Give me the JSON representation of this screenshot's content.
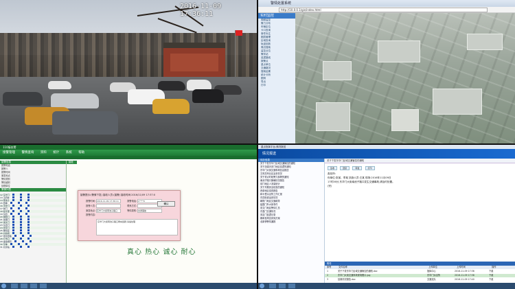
{
  "camera": {
    "timestamp": "2016-11-09 17:36:11"
  },
  "browser": {
    "window_title": "警情处置系统",
    "address": "http://10.0.0.1/gis/index.html",
    "sidebar_title": "实时监控",
    "sidebar_items": [
      "视频监控",
      "警力分布",
      "车辆定位",
      "卡口查询",
      "事件标注",
      "图层管理",
      "区域查询",
      "轨迹回放",
      "周边搜索",
      "监控点位",
      "警务站",
      "巡逻路线",
      "报警点",
      "重点单位",
      "交通路况",
      "搜索结果",
      "统计分析",
      "图例",
      "导出",
      "打印"
    ]
  },
  "system110": {
    "title": "110接处警",
    "menu": [
      "接警管理",
      "警情查询",
      "资料",
      "统计",
      "系统",
      "帮助"
    ],
    "left_header": "接警信息",
    "form_rows": [
      "报警电话",
      "报警人",
      "报警时间",
      "案发地点",
      "警情类别",
      "警情级别",
      "处理单位"
    ],
    "list_header": "警情列表",
    "list_rows": [
      "12 东华门",
      "13 王府井",
      "14 南池子",
      "15 西单",
      "16 天安门",
      "17 前门",
      "18 和平里",
      "19 东四",
      "20 朝阳门",
      "21 建国门",
      "22 崇文门",
      "23 东直门",
      "24 安定门",
      "25 雍和宫",
      "26 北新桥",
      "27 张自忠路",
      "28 灯市口",
      "29 金鱼胡同",
      "30 东单",
      "31 北京站"
    ],
    "main_header": "接处",
    "slogan": "真心 热心 诚心 耐心",
    "dialog": {
      "title": "接警提示:(警情下发) 接收人员:(接警) 接收时间:2016/11/09 17:37:0",
      "rows": [
        {
          "label": "报警时间:",
          "value": "2016-11-09 17:36:11",
          "label2": "报警电话:",
          "value2": "1****0"
        },
        {
          "label": "报警人员:",
          "value": "",
          "label2": "联系方式:",
          "value2": ""
        },
        {
          "label": "案发地点:",
          "value": "东华门大街南池子路口",
          "label2": "警情类别:",
          "value2": "交通事故"
        }
      ],
      "content_label": "报警内容:",
      "content": "东华门大街南池子路口两车刮蹭,请速处理",
      "button": "确认"
    }
  },
  "dispatch": {
    "title": "重点指挥平台-情况报送",
    "brand": "情况报送",
    "nav": [
      "首页",
      "信息报送",
      "信息查询",
      "信息处理",
      "统计分析",
      "系统设置"
    ],
    "left_header": "待办信息",
    "left_items": [
      "关于下发东华门区域交通管控的通知",
      "关于加强天安门地区巡逻的通知",
      "东华门大街交通事故信息报送",
      "王府井商业区治安情况",
      "关于重点时段警力部署的通知",
      "南池子路口拥堵情况报告",
      "前门地区人流量统计",
      "关于开展安全检查的通知",
      "西单地区巡查报告",
      "和平里派出所工作汇报",
      "东四街道治安情况",
      "朝阳门地区交通疏导",
      "建国门外大街事件",
      "崇文门地区警情汇总",
      "东直门交通情况",
      "安定门巡逻记录",
      "雍和宫周边安保方案",
      "北新桥警情通报"
    ],
    "detail_header": "关于下发东华门区域交通管控的通知",
    "detail_lines": [
      "各处所:",
      "你单位:张某、李某 执勤人员:王某 现场:2016年11月09日",
      "17时36分,东华门大街南池子路口发生交通事故,请及时处置。",
      "(完)"
    ],
    "table_header": "附件",
    "table_cols": [
      "序号",
      "文件名称",
      "上传单位",
      "上传时间",
      "操作"
    ],
    "table_rows": [
      {
        "cells": [
          "1",
          "关于下发东华门区域交通管控的通知.doc",
          "指挥中心",
          "2016-11-09 17:36",
          "下载"
        ],
        "highlight": false
      },
      {
        "cells": [
          "2",
          "东华门大街交通事故现场照片.jpg",
          "东华门派出所",
          "2016-11-09 17:38",
          "下载"
        ],
        "highlight": true
      },
      {
        "cells": [
          "3",
          "处置情况报告.doc",
          "交通支队",
          "2016-11-09 17:40",
          "下载"
        ],
        "highlight": false
      }
    ],
    "pills": [
      "签收",
      "回复",
      "转发",
      "打印"
    ]
  }
}
